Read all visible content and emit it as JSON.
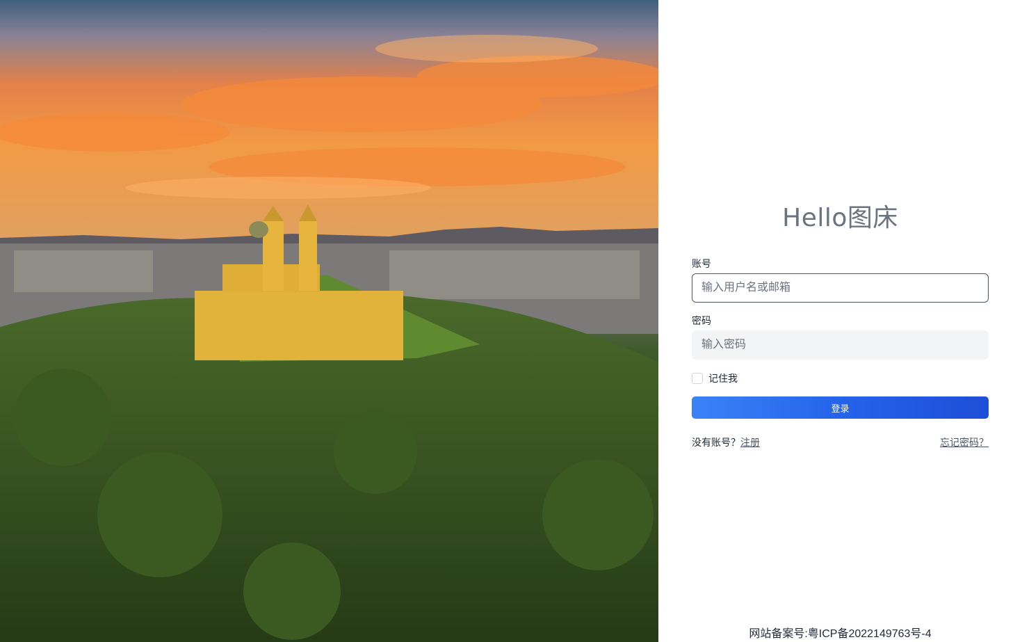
{
  "login": {
    "title": "Hello图床",
    "username_label": "账号",
    "username_placeholder": "输入用户名或邮箱",
    "password_label": "密码",
    "password_placeholder": "输入密码",
    "remember_label": "记住我",
    "submit_label": "登录",
    "no_account_text": "没有账号？",
    "register_link": "注册",
    "forgot_link": "忘记密码？"
  },
  "footer": {
    "icp": "网站备案号:粤ICP备2022149763号-4"
  },
  "colors": {
    "primary": "#2563eb",
    "muted_text": "#6b7280"
  }
}
